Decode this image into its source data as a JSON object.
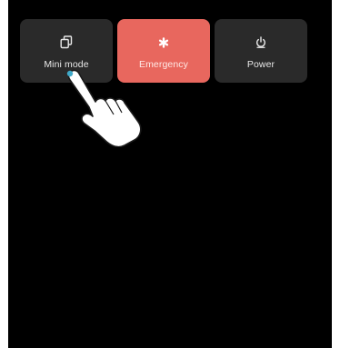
{
  "power_menu": {
    "tiles": [
      {
        "label": "Mini mode",
        "icon": "mini-mode-icon"
      },
      {
        "label": "Emergency",
        "icon": "emergency-icon"
      },
      {
        "label": "Power",
        "icon": "power-icon"
      }
    ],
    "more_icon": "more-vertical-icon"
  },
  "colors": {
    "background": "#000000",
    "tile": "#2a2a2a",
    "emergency": "#e8675e",
    "touch_point": "#3fa9c9"
  }
}
